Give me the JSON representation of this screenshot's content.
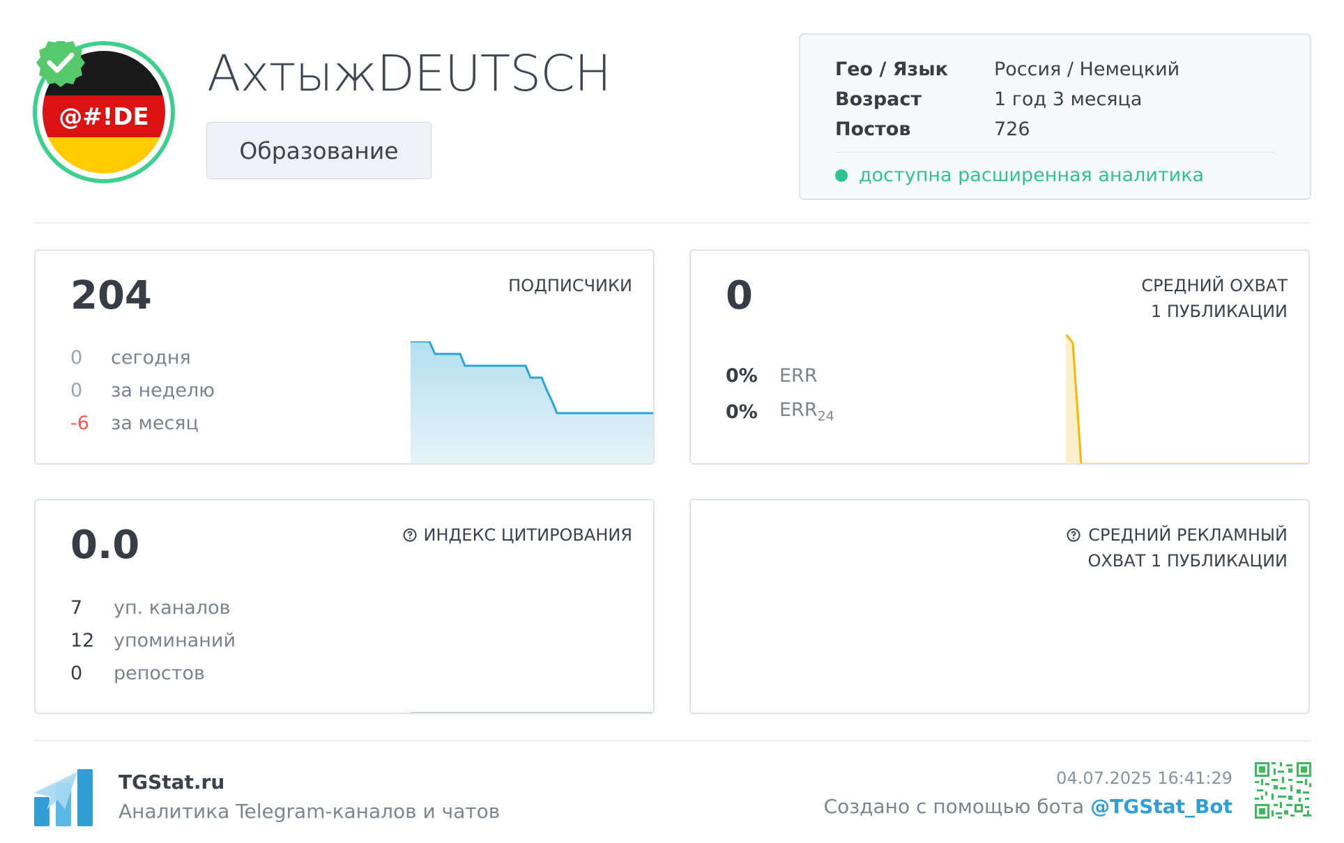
{
  "channel": {
    "title": "АхтыжDEUTSCH",
    "category": "Образование",
    "avatar_text": "@#!DE"
  },
  "info": {
    "rows": [
      {
        "key": "Гео / Язык",
        "value": "Россия / Немецкий"
      },
      {
        "key": "Возраст",
        "value": "1 год 3 месяца"
      },
      {
        "key": "Постов",
        "value": "726"
      }
    ],
    "status": "доступна расширенная аналитика"
  },
  "subscribers": {
    "value": "204",
    "label": "ПОДПИСЧИКИ",
    "stats": [
      {
        "num": "0",
        "label": "сегодня"
      },
      {
        "num": "0",
        "label": "за неделю"
      },
      {
        "num": "-6",
        "label": "за месяц"
      }
    ]
  },
  "reach": {
    "value": "0",
    "label_line1": "СРЕДНИЙ ОХВАТ",
    "label_line2": "1 ПУБЛИКАЦИИ",
    "err_value": "0%",
    "err_label": "ERR",
    "err24_value": "0%",
    "err24_label": "ERR",
    "err24_sub": "24"
  },
  "citation": {
    "value": "0.0",
    "label": "ИНДЕКС ЦИТИРОВАНИЯ",
    "stats": [
      {
        "num": "7",
        "label": "уп. каналов"
      },
      {
        "num": "12",
        "label": "упоминаний"
      },
      {
        "num": "0",
        "label": "репостов"
      }
    ]
  },
  "ad_reach": {
    "label_line1": "СРЕДНИЙ РЕКЛАМНЫЙ",
    "label_line2": "ОХВАТ 1 ПУБЛИКАЦИИ"
  },
  "footer": {
    "brand": "TGStat.ru",
    "tagline": "Аналитика Telegram-каналов и чатов",
    "timestamp": "04.07.2025 16:41:29",
    "credit_prefix": "Создано с помощью бота ",
    "bot": "@TGStat_Bot"
  },
  "colors": {
    "accent_green": "#2fc48d",
    "subscribers_line": "#2aa4d6",
    "reach_line": "#f5b800",
    "citation_line": "#3dbb5c",
    "negative": "#f05a52",
    "link": "#2f9fd6"
  }
}
